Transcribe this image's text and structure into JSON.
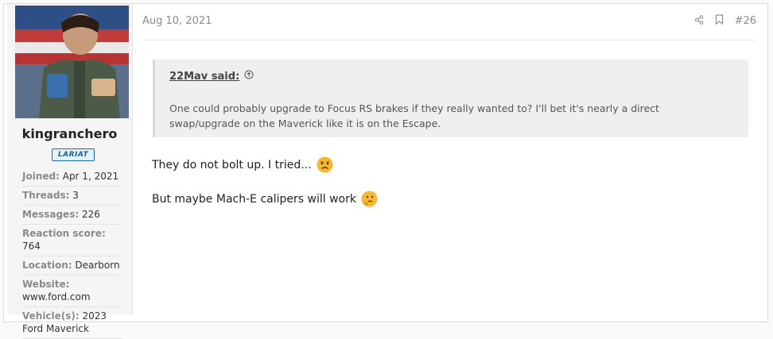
{
  "post": {
    "date": "Aug 10, 2021",
    "number": "#26"
  },
  "user": {
    "name": "kingranchero",
    "badge": "LARIAT",
    "stats": [
      {
        "key": "Joined:",
        "value": "Apr 1, 2021"
      },
      {
        "key": "Threads:",
        "value": "3"
      },
      {
        "key": "Messages:",
        "value": "226"
      },
      {
        "key": "Reaction score:",
        "value": "764"
      },
      {
        "key": "Location:",
        "value": "Dearborn"
      },
      {
        "key": "Website:",
        "value": "www.ford.com"
      },
      {
        "key": "Vehicle(s):",
        "value": "2023 Ford Maverick"
      }
    ]
  },
  "quote": {
    "author": "22Mav said:",
    "text": "One could probably upgrade to Focus RS brakes if they really wanted to? I'll bet it's nearly a direct swap/upgrade on the Maverick like it is on the Escape."
  },
  "message": {
    "line1": "They do not bolt up. I tried...",
    "line2": "But maybe Mach-E calipers will work"
  },
  "icons": {
    "share": "share-icon",
    "bookmark": "bookmark-icon",
    "quote_jump": "arrow-up-circle-icon",
    "emoji1": "sad-face-emoji",
    "emoji2": "thinking-face-emoji"
  }
}
